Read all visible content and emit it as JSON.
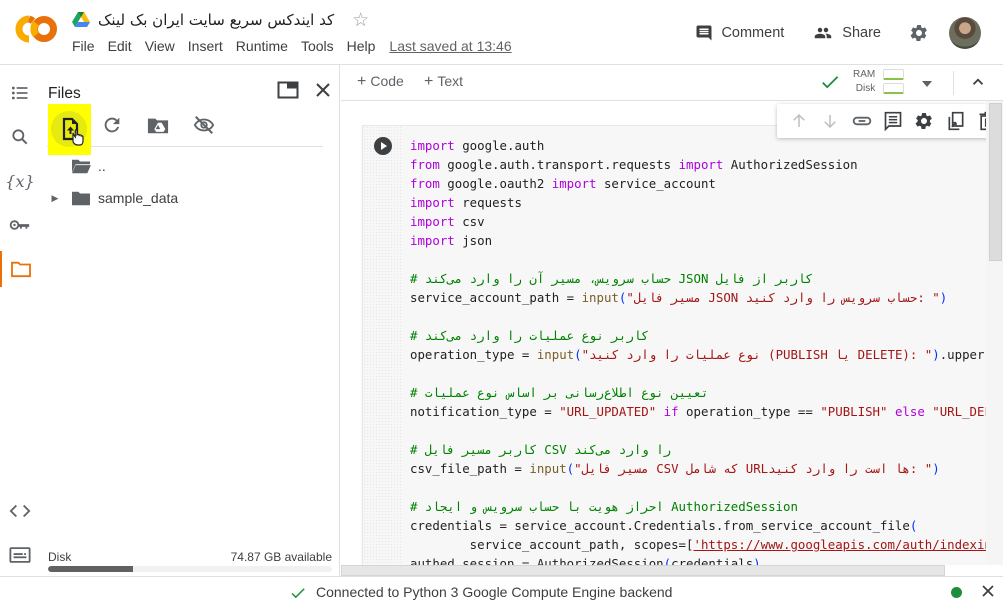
{
  "header": {
    "logo": "colab-logo",
    "drive_icon": "google-drive-icon",
    "doc_title": "کد ایندکس سریع سایت ایران بک لینک",
    "star_icon": "star-outline-icon",
    "menu": [
      "File",
      "Edit",
      "View",
      "Insert",
      "Runtime",
      "Tools",
      "Help"
    ],
    "last_saved": "Last saved at 13:46",
    "comment_label": "Comment",
    "share_label": "Share",
    "settings_icon": "gear-icon",
    "avatar": "user-avatar"
  },
  "rail": {
    "items": [
      {
        "name": "table-of-contents",
        "icon": "list-icon"
      },
      {
        "name": "find-and-replace",
        "icon": "search-icon"
      },
      {
        "name": "variables",
        "icon": "variable-x-icon"
      },
      {
        "name": "secrets",
        "icon": "key-icon"
      },
      {
        "name": "files",
        "icon": "folder-icon",
        "active": true
      },
      {
        "name": "code-snippets",
        "icon": "code-brackets-icon"
      },
      {
        "name": "command-palette",
        "icon": "terminal-icon"
      }
    ]
  },
  "files_panel": {
    "title": "Files",
    "toolbar": [
      "upload-file-icon",
      "refresh-icon",
      "mount-drive-icon",
      "hide-files-icon"
    ],
    "tree": [
      {
        "label": "..",
        "type": "parent-folder"
      },
      {
        "label": "sample_data",
        "type": "folder",
        "collapsed": true
      }
    ],
    "disk": {
      "label": "Disk",
      "available": "74.87 GB available",
      "used_fraction": 0.3
    }
  },
  "notebook_toolbar": {
    "add_code": "Code",
    "add_text": "Text",
    "ram_label": "RAM",
    "disk_label": "Disk",
    "connected": true
  },
  "cell_actions": [
    "arrow-up-icon",
    "arrow-down-icon",
    "link-icon",
    "comment-icon",
    "gear-icon",
    "mirror-cell-icon",
    "delete-icon"
  ],
  "code_lines": [
    [
      [
        "kw",
        "import"
      ],
      [
        "t",
        " google.auth"
      ]
    ],
    [
      [
        "kw",
        "from"
      ],
      [
        "t",
        " google.auth.transport.requests "
      ],
      [
        "kw",
        "import"
      ],
      [
        "t",
        " AuthorizedSession"
      ]
    ],
    [
      [
        "kw",
        "from"
      ],
      [
        "t",
        " google.oauth2 "
      ],
      [
        "kw",
        "import"
      ],
      [
        "t",
        " service_account"
      ]
    ],
    [
      [
        "kw",
        "import"
      ],
      [
        "t",
        " requests"
      ]
    ],
    [
      [
        "kw",
        "import"
      ],
      [
        "t",
        " csv"
      ]
    ],
    [
      [
        "kw",
        "import"
      ],
      [
        "t",
        " json"
      ]
    ],
    [],
    [
      [
        "cm",
        "# حساب سرویس، مسیر آن را وارد می‌کند JSON کاربر از فایل"
      ]
    ],
    [
      [
        "t",
        "service_account_path = "
      ],
      [
        "fn",
        "input"
      ],
      [
        "paren",
        "("
      ],
      [
        "str",
        "\"مسیر فایل JSON حساب سرویس را وارد کنید: \""
      ],
      [
        "paren",
        ")"
      ]
    ],
    [],
    [
      [
        "cm",
        "# کاربر نوع عملیات را وارد می‌کند"
      ]
    ],
    [
      [
        "t",
        "operation_type = "
      ],
      [
        "fn",
        "input"
      ],
      [
        "paren",
        "("
      ],
      [
        "str",
        "\"نوع عملیات را وارد کنید (PUBLISH یا DELETE): \""
      ],
      [
        "paren",
        ")"
      ],
      [
        "t",
        ".upper()"
      ]
    ],
    [],
    [
      [
        "cm",
        "# تعیین نوع اطلاع‌رسانی بر اساس نوع عملیات"
      ]
    ],
    [
      [
        "t",
        "notification_type = "
      ],
      [
        "str",
        "\"URL_UPDATED\""
      ],
      [
        "t",
        " "
      ],
      [
        "kw",
        "if"
      ],
      [
        "t",
        " operation_type == "
      ],
      [
        "str",
        "\"PUBLISH\""
      ],
      [
        "t",
        " "
      ],
      [
        "kw",
        "else"
      ],
      [
        "t",
        " "
      ],
      [
        "str",
        "\"URL_DELETED\""
      ]
    ],
    [],
    [
      [
        "cm",
        "# کاربر مسیر فایل CSV را وارد می‌کند"
      ]
    ],
    [
      [
        "t",
        "csv_file_path = "
      ],
      [
        "fn",
        "input"
      ],
      [
        "paren",
        "("
      ],
      [
        "str",
        "\"مسیر فایل CSV که شامل URLها است را وارد کنید: \""
      ],
      [
        "paren",
        ")"
      ]
    ],
    [],
    [
      [
        "cm",
        "# احراز هویت با حساب سرویس و ایجاد AuthorizedSession"
      ]
    ],
    [
      [
        "t",
        "credentials = service_account.Credentials.from_service_account_file"
      ],
      [
        "paren",
        "("
      ]
    ],
    [
      [
        "t",
        "        service_account_path, scopes=["
      ],
      [
        "url",
        "'https://www.googleapis.com/auth/indexing'"
      ],
      [
        "t",
        "])"
      ]
    ],
    [
      [
        "t",
        "authed_session = AuthorizedSession"
      ],
      [
        "paren",
        "("
      ],
      [
        "t",
        "credentials"
      ],
      [
        "paren",
        ")"
      ]
    ]
  ],
  "statusbar": {
    "text": "Connected to Python 3 Google Compute Engine backend",
    "status_color": "#1e8e3e"
  },
  "colors": {
    "accent": "#e8710a",
    "highlight": "#ffff00",
    "success": "#1e8e3e"
  }
}
